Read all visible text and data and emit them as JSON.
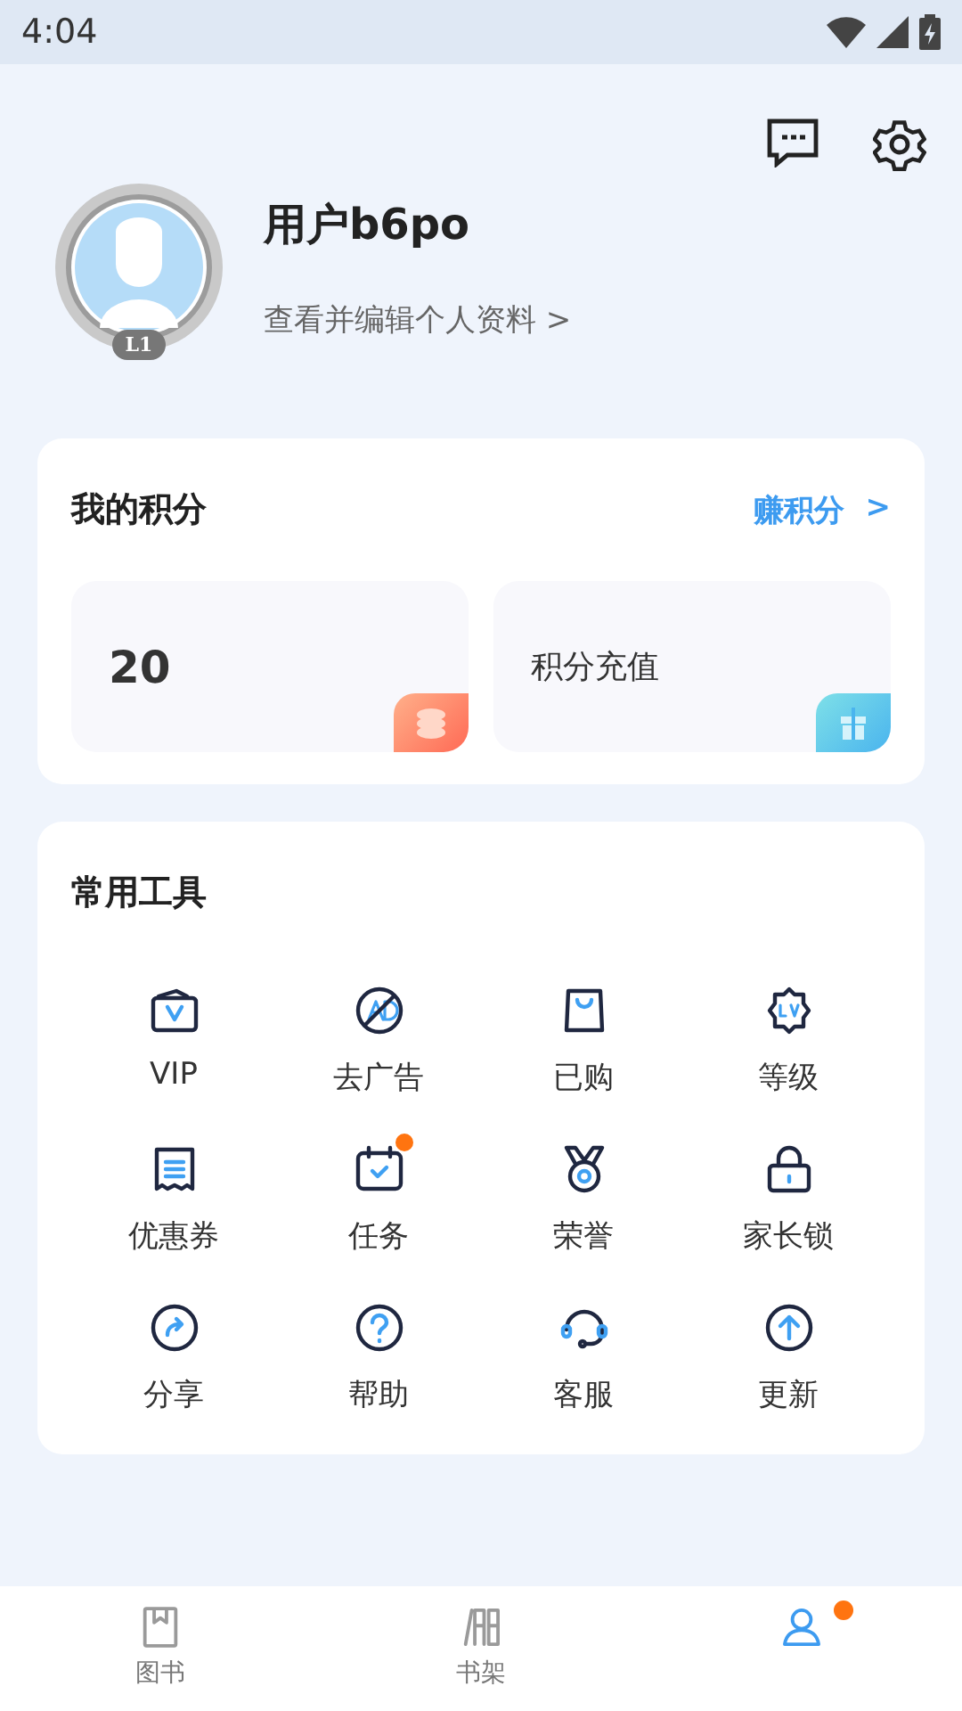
{
  "status_bar": {
    "time": "4:04"
  },
  "profile": {
    "name": "用户b6po",
    "link": "查看并编辑个人资料 >",
    "level_badge": "L1"
  },
  "points": {
    "title": "我的积分",
    "action": "赚积分",
    "action_arrow": ">",
    "tiles": [
      {
        "kind": "balance",
        "text": "20"
      },
      {
        "kind": "recharge",
        "text": "积分充值"
      }
    ]
  },
  "tools": {
    "title": "常用工具",
    "items": [
      {
        "label": "VIP",
        "badge": false
      },
      {
        "label": "去广告",
        "badge": false
      },
      {
        "label": "已购",
        "badge": false
      },
      {
        "label": "等级",
        "badge": false
      },
      {
        "label": "优惠券",
        "badge": false
      },
      {
        "label": "任务",
        "badge": true
      },
      {
        "label": "荣誉",
        "badge": false
      },
      {
        "label": "家长锁",
        "badge": false
      },
      {
        "label": "分享",
        "badge": false
      },
      {
        "label": "帮助",
        "badge": false
      },
      {
        "label": "客服",
        "badge": false
      },
      {
        "label": "更新",
        "badge": false
      }
    ]
  },
  "bottom_nav": [
    {
      "label": "图书",
      "selected": false,
      "badge": false
    },
    {
      "label": "书架",
      "selected": false,
      "badge": false
    },
    {
      "selected": true,
      "badge": true
    }
  ]
}
